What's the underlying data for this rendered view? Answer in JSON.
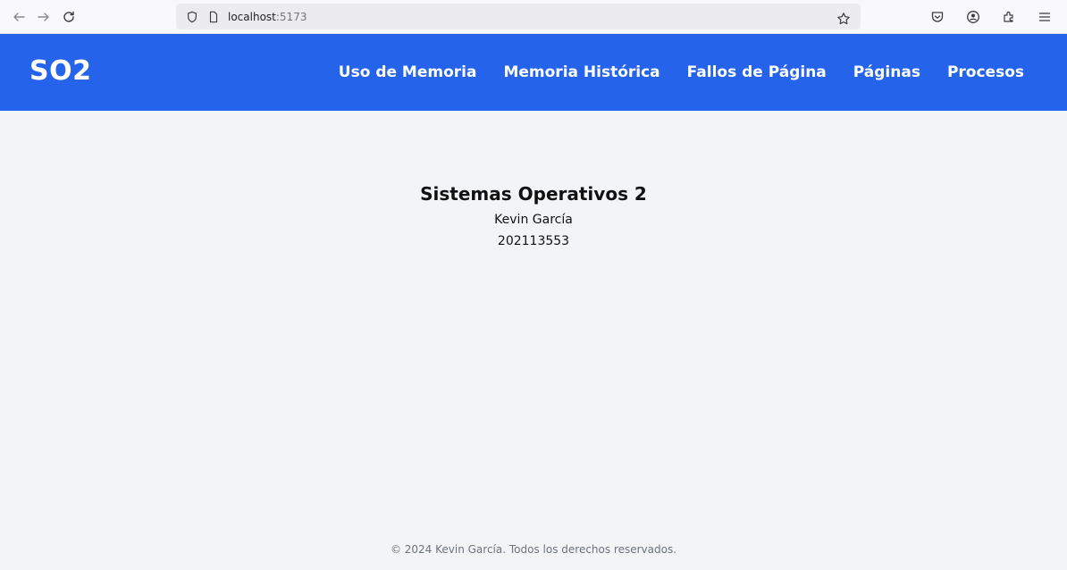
{
  "browser": {
    "url_host": "localhost",
    "url_port": ":5173",
    "icons": {
      "back": "back-arrow-icon",
      "forward": "forward-arrow-icon",
      "reload": "reload-icon",
      "shield": "shield-icon",
      "page": "page-icon",
      "bookmark": "star-icon",
      "pocket": "pocket-icon",
      "account": "account-icon",
      "extensions": "extensions-icon",
      "menu": "hamburger-menu-icon"
    }
  },
  "navbar": {
    "brand": "SO2",
    "background": "#2563eb",
    "links": [
      {
        "label": "Uso de Memoria"
      },
      {
        "label": "Memoria Histórica"
      },
      {
        "label": "Fallos de Página"
      },
      {
        "label": "Páginas"
      },
      {
        "label": "Procesos"
      }
    ]
  },
  "main": {
    "title": "Sistemas Operativos 2",
    "author": "Kevin García",
    "id_number": "202113553"
  },
  "footer": {
    "text": "© 2024 Kevin García. Todos los derechos reservados."
  }
}
